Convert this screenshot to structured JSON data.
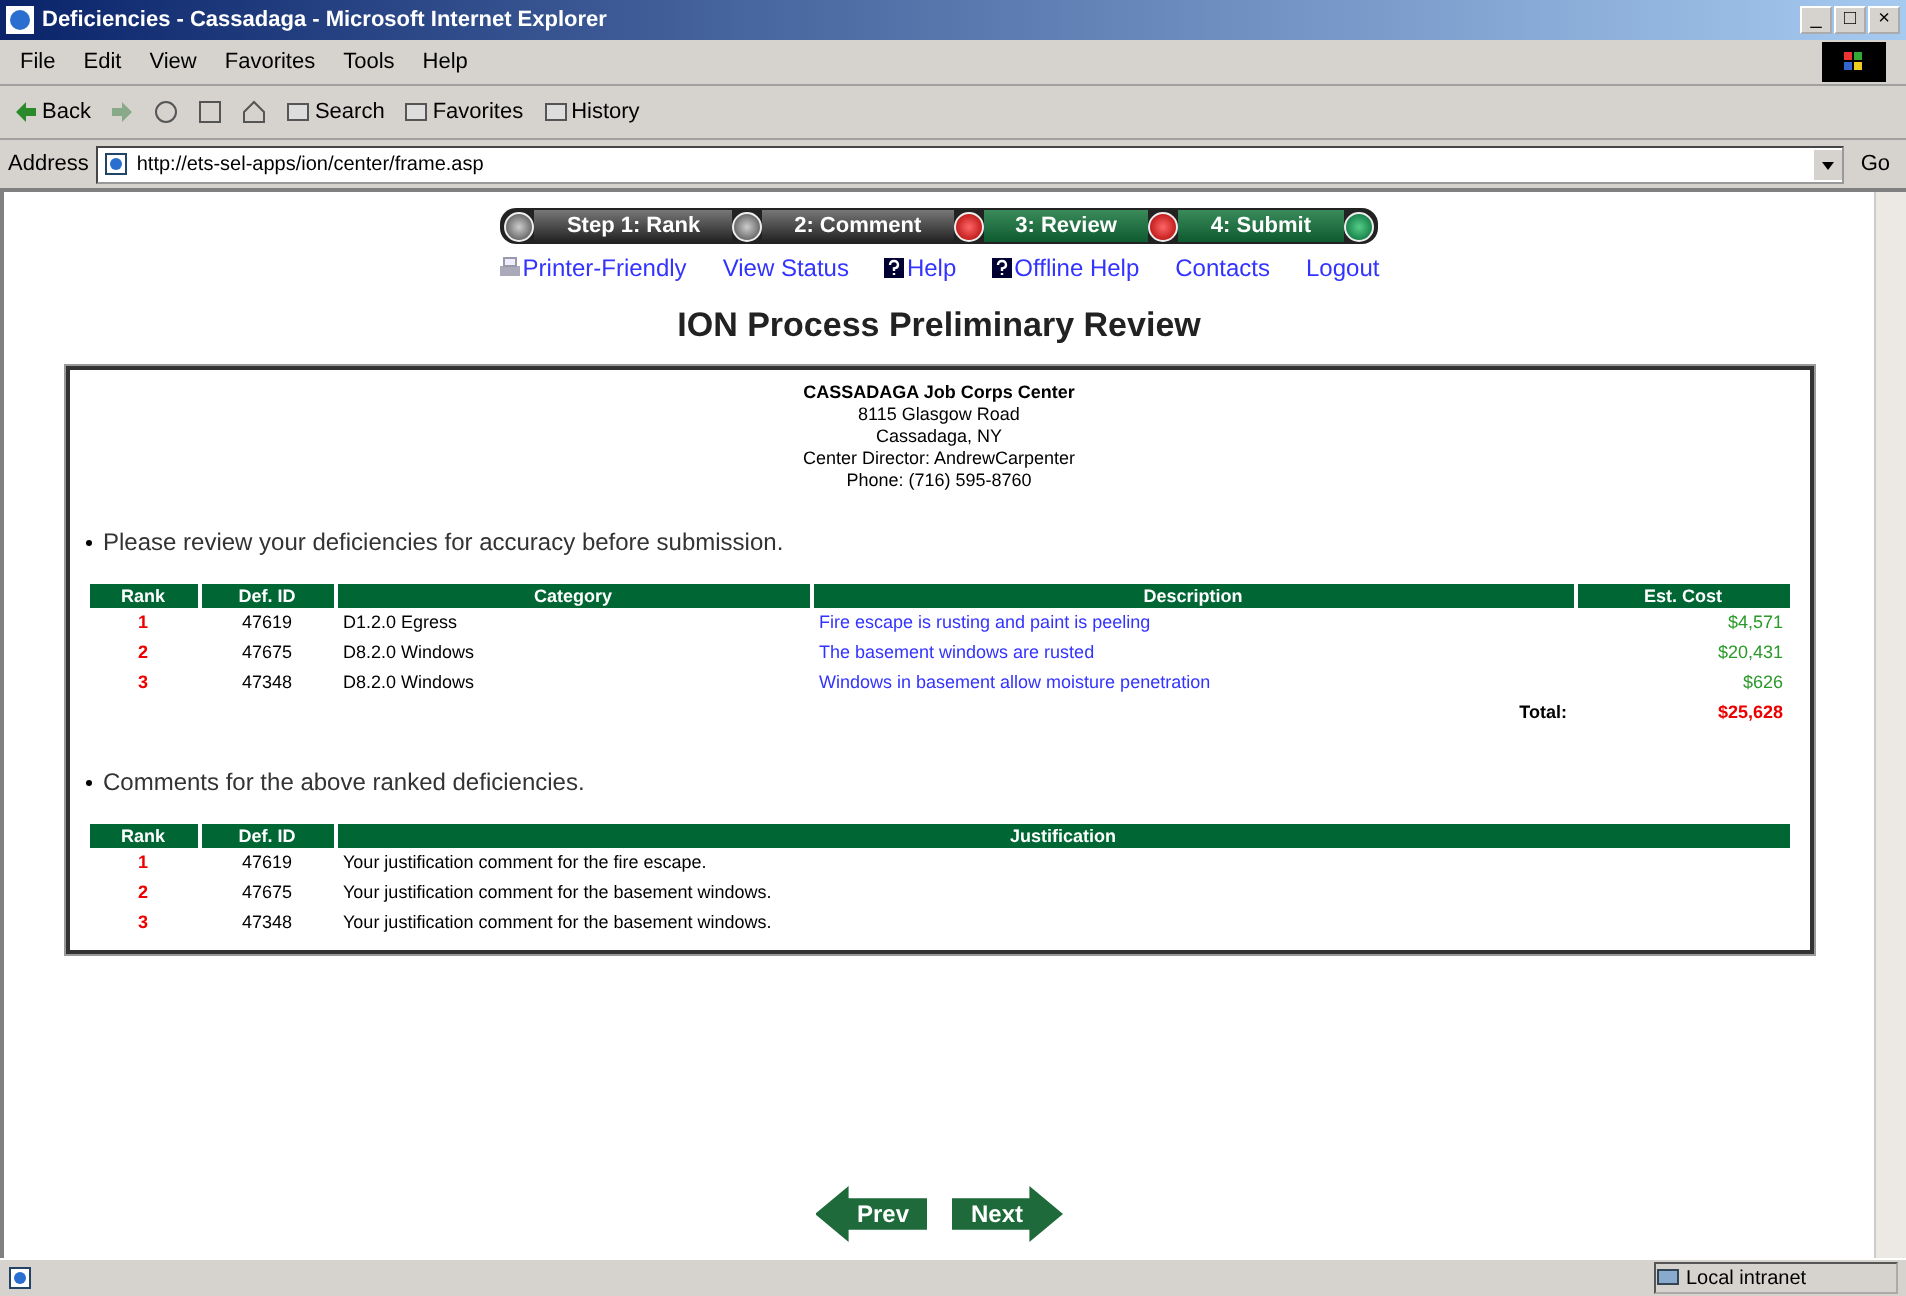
{
  "window": {
    "title": "Deficiencies - Cassadaga - Microsoft Internet Explorer",
    "controls": [
      "_",
      "□",
      "×"
    ]
  },
  "menu": [
    "File",
    "Edit",
    "View",
    "Favorites",
    "Tools",
    "Help"
  ],
  "toolbar": [
    "Back",
    "Search",
    "Favorites",
    "History"
  ],
  "address": {
    "label": "Address",
    "value": "http://ets-sel-apps/ion/center/frame.asp",
    "go": "Go"
  },
  "steps": [
    {
      "label": "Step 1: Rank",
      "enabled": false
    },
    {
      "label": "2: Comment",
      "enabled": false
    },
    {
      "label": "3: Review",
      "enabled": true
    },
    {
      "label": "4: Submit",
      "enabled": true
    }
  ],
  "links": [
    {
      "label": "Printer-Friendly",
      "kind": "printer"
    },
    {
      "label": "View Status",
      "kind": "plain"
    },
    {
      "label": "Help",
      "kind": "help"
    },
    {
      "label": "Offline Help",
      "kind": "help"
    },
    {
      "label": "Contacts",
      "kind": "plain"
    },
    {
      "label": "Logout",
      "kind": "plain"
    }
  ],
  "heading": "ION Process Preliminary Review",
  "center": {
    "name": "CASSADAGA Job Corps Center",
    "lines": [
      "8115 Glasgow Road",
      "Cassadaga, NY",
      "Center Director: AndrewCarpenter",
      "Phone: (716) 595-8760"
    ]
  },
  "review_note": "Please review your deficiencies for accuracy before submission.",
  "deficiencies": {
    "columns": [
      "Rank",
      "Def. ID",
      "Category",
      "Description",
      "Est. Cost"
    ],
    "rows": [
      {
        "rank": "1",
        "id": "47619",
        "category": "D1.2.0 Egress",
        "description": "Fire escape is rusting and paint is peeling",
        "cost": "$4,571"
      },
      {
        "rank": "2",
        "id": "47675",
        "category": "D8.2.0 Windows",
        "description": "The basement windows are rusted",
        "cost": "$20,431"
      },
      {
        "rank": "3",
        "id": "47348",
        "category": "D8.2.0 Windows",
        "description": "Windows in basement allow moisture penetration",
        "cost": "$626"
      }
    ],
    "total_label": "Total:",
    "total": "$25,628"
  },
  "comments_note": "Comments for the above ranked deficiencies.",
  "comments": {
    "columns": [
      "Rank",
      "Def. ID",
      "Justification"
    ],
    "rows": [
      {
        "rank": "1",
        "id": "47619",
        "text": "Your justification comment for the fire escape."
      },
      {
        "rank": "2",
        "id": "47675",
        "text": "Your justification comment for the basement windows."
      },
      {
        "rank": "3",
        "id": "47348",
        "text": "Your justification comment for the basement windows."
      }
    ]
  },
  "nav": {
    "prev": "Prev",
    "next": "Next"
  },
  "status_bar": {
    "zone": "Local intranet"
  }
}
